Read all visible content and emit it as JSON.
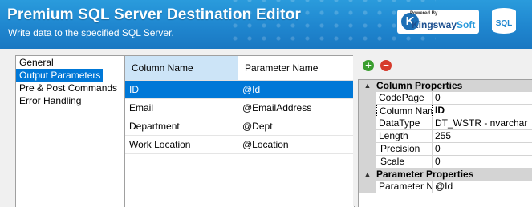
{
  "header": {
    "title": "Premium SQL Server Destination Editor",
    "subtitle": "Write data to the specified SQL Server.",
    "logo": {
      "powered_by": "Powered By",
      "brand_a": "Kingsway",
      "brand_b": "Soft",
      "k": "K"
    },
    "db_icon_label": "SQL",
    "colors": {
      "header": "#1f86cf",
      "accent": "#0078d7"
    }
  },
  "nav": {
    "items": [
      {
        "label": "General"
      },
      {
        "label": "Output Parameters"
      },
      {
        "label": "Pre & Post Commands"
      },
      {
        "label": "Error Handling"
      }
    ]
  },
  "grid": {
    "columns": [
      "Column Name",
      "Parameter Name"
    ],
    "rows": [
      [
        "ID",
        "@Id"
      ],
      [
        "Email",
        "@EmailAddress"
      ],
      [
        "Department",
        "@Dept"
      ],
      [
        "Work Location",
        "@Location"
      ]
    ]
  },
  "properties": {
    "toolbar": {
      "add_icon": "add-icon",
      "remove_icon": "remove-icon"
    },
    "cat1": {
      "label": "Column Properties",
      "toggle": "▲"
    },
    "rows1": [
      {
        "key": "CodePage",
        "value": "0"
      },
      {
        "key": "Column Name",
        "value": "ID"
      },
      {
        "key": "DataType",
        "value": "DT_WSTR - nvarchar"
      },
      {
        "key": "Length",
        "value": "255"
      },
      {
        "key": "Precision",
        "value": "0"
      },
      {
        "key": "Scale",
        "value": "0"
      }
    ],
    "cat2": {
      "label": "Parameter Properties",
      "toggle": "▲"
    },
    "rows2": [
      {
        "key": "Parameter Name",
        "value": "@Id"
      }
    ]
  }
}
